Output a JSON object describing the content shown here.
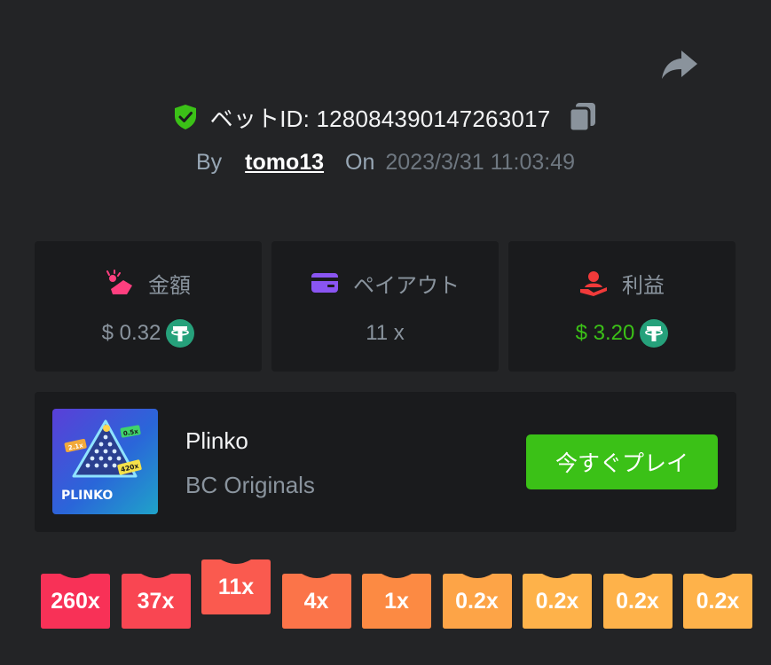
{
  "header": {
    "bet_id_label": "ベットID: 128084390147263017",
    "by_label": "By",
    "username": "tomo13",
    "on_label": "On",
    "datetime": "2023/3/31 11:03:49"
  },
  "stats": {
    "amount": {
      "label": "金額",
      "value": "$ 0.32",
      "icon": "money-hand-icon"
    },
    "payout": {
      "label": "ペイアウト",
      "value": "11 x",
      "icon": "card-icon"
    },
    "profit": {
      "label": "利益",
      "value": "$ 3.20",
      "icon": "profit-person-icon"
    }
  },
  "game": {
    "title": "Plinko",
    "provider": "BC Originals",
    "play_label": "今すぐプレイ",
    "thumb": {
      "name": "PLINKO",
      "tag_a": "2.1x",
      "tag_b": "0.5x",
      "tag_c": "420x"
    }
  },
  "multipliers": [
    {
      "label": "260x",
      "color": "#f83157",
      "active": false
    },
    {
      "label": "37x",
      "color": "#f94652",
      "active": false
    },
    {
      "label": "11x",
      "color": "#fa5a4f",
      "active": true
    },
    {
      "label": "4x",
      "color": "#fb7449",
      "active": false
    },
    {
      "label": "1x",
      "color": "#fc8a43",
      "active": false
    },
    {
      "label": "0.2x",
      "color": "#fda447",
      "active": false
    },
    {
      "label": "0.2x",
      "color": "#feb24a",
      "active": false
    },
    {
      "label": "0.2x",
      "color": "#feb24a",
      "active": false
    },
    {
      "label": "0.2x",
      "color": "#feb24a",
      "active": false
    }
  ],
  "colors": {
    "background": "#232426",
    "card": "#1a1b1d",
    "accent_green": "#3bc117",
    "tether_green": "#26a17b",
    "muted": "#8a949e"
  }
}
